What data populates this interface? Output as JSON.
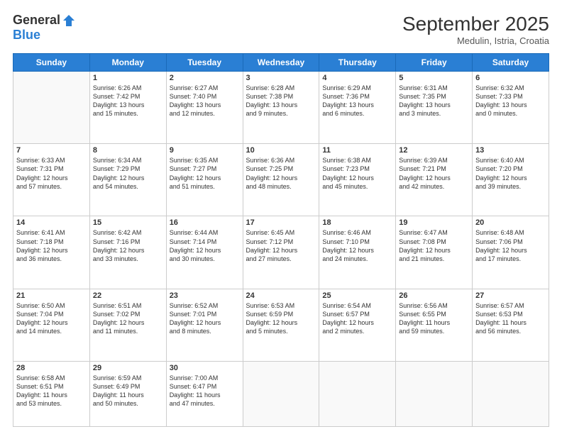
{
  "header": {
    "logo_general": "General",
    "logo_blue": "Blue",
    "month_title": "September 2025",
    "subtitle": "Medulin, Istria, Croatia"
  },
  "days_of_week": [
    "Sunday",
    "Monday",
    "Tuesday",
    "Wednesday",
    "Thursday",
    "Friday",
    "Saturday"
  ],
  "weeks": [
    [
      {
        "day": "",
        "content": ""
      },
      {
        "day": "1",
        "content": "Sunrise: 6:26 AM\nSunset: 7:42 PM\nDaylight: 13 hours\nand 15 minutes."
      },
      {
        "day": "2",
        "content": "Sunrise: 6:27 AM\nSunset: 7:40 PM\nDaylight: 13 hours\nand 12 minutes."
      },
      {
        "day": "3",
        "content": "Sunrise: 6:28 AM\nSunset: 7:38 PM\nDaylight: 13 hours\nand 9 minutes."
      },
      {
        "day": "4",
        "content": "Sunrise: 6:29 AM\nSunset: 7:36 PM\nDaylight: 13 hours\nand 6 minutes."
      },
      {
        "day": "5",
        "content": "Sunrise: 6:31 AM\nSunset: 7:35 PM\nDaylight: 13 hours\nand 3 minutes."
      },
      {
        "day": "6",
        "content": "Sunrise: 6:32 AM\nSunset: 7:33 PM\nDaylight: 13 hours\nand 0 minutes."
      }
    ],
    [
      {
        "day": "7",
        "content": "Sunrise: 6:33 AM\nSunset: 7:31 PM\nDaylight: 12 hours\nand 57 minutes."
      },
      {
        "day": "8",
        "content": "Sunrise: 6:34 AM\nSunset: 7:29 PM\nDaylight: 12 hours\nand 54 minutes."
      },
      {
        "day": "9",
        "content": "Sunrise: 6:35 AM\nSunset: 7:27 PM\nDaylight: 12 hours\nand 51 minutes."
      },
      {
        "day": "10",
        "content": "Sunrise: 6:36 AM\nSunset: 7:25 PM\nDaylight: 12 hours\nand 48 minutes."
      },
      {
        "day": "11",
        "content": "Sunrise: 6:38 AM\nSunset: 7:23 PM\nDaylight: 12 hours\nand 45 minutes."
      },
      {
        "day": "12",
        "content": "Sunrise: 6:39 AM\nSunset: 7:21 PM\nDaylight: 12 hours\nand 42 minutes."
      },
      {
        "day": "13",
        "content": "Sunrise: 6:40 AM\nSunset: 7:20 PM\nDaylight: 12 hours\nand 39 minutes."
      }
    ],
    [
      {
        "day": "14",
        "content": "Sunrise: 6:41 AM\nSunset: 7:18 PM\nDaylight: 12 hours\nand 36 minutes."
      },
      {
        "day": "15",
        "content": "Sunrise: 6:42 AM\nSunset: 7:16 PM\nDaylight: 12 hours\nand 33 minutes."
      },
      {
        "day": "16",
        "content": "Sunrise: 6:44 AM\nSunset: 7:14 PM\nDaylight: 12 hours\nand 30 minutes."
      },
      {
        "day": "17",
        "content": "Sunrise: 6:45 AM\nSunset: 7:12 PM\nDaylight: 12 hours\nand 27 minutes."
      },
      {
        "day": "18",
        "content": "Sunrise: 6:46 AM\nSunset: 7:10 PM\nDaylight: 12 hours\nand 24 minutes."
      },
      {
        "day": "19",
        "content": "Sunrise: 6:47 AM\nSunset: 7:08 PM\nDaylight: 12 hours\nand 21 minutes."
      },
      {
        "day": "20",
        "content": "Sunrise: 6:48 AM\nSunset: 7:06 PM\nDaylight: 12 hours\nand 17 minutes."
      }
    ],
    [
      {
        "day": "21",
        "content": "Sunrise: 6:50 AM\nSunset: 7:04 PM\nDaylight: 12 hours\nand 14 minutes."
      },
      {
        "day": "22",
        "content": "Sunrise: 6:51 AM\nSunset: 7:02 PM\nDaylight: 12 hours\nand 11 minutes."
      },
      {
        "day": "23",
        "content": "Sunrise: 6:52 AM\nSunset: 7:01 PM\nDaylight: 12 hours\nand 8 minutes."
      },
      {
        "day": "24",
        "content": "Sunrise: 6:53 AM\nSunset: 6:59 PM\nDaylight: 12 hours\nand 5 minutes."
      },
      {
        "day": "25",
        "content": "Sunrise: 6:54 AM\nSunset: 6:57 PM\nDaylight: 12 hours\nand 2 minutes."
      },
      {
        "day": "26",
        "content": "Sunrise: 6:56 AM\nSunset: 6:55 PM\nDaylight: 11 hours\nand 59 minutes."
      },
      {
        "day": "27",
        "content": "Sunrise: 6:57 AM\nSunset: 6:53 PM\nDaylight: 11 hours\nand 56 minutes."
      }
    ],
    [
      {
        "day": "28",
        "content": "Sunrise: 6:58 AM\nSunset: 6:51 PM\nDaylight: 11 hours\nand 53 minutes."
      },
      {
        "day": "29",
        "content": "Sunrise: 6:59 AM\nSunset: 6:49 PM\nDaylight: 11 hours\nand 50 minutes."
      },
      {
        "day": "30",
        "content": "Sunrise: 7:00 AM\nSunset: 6:47 PM\nDaylight: 11 hours\nand 47 minutes."
      },
      {
        "day": "",
        "content": ""
      },
      {
        "day": "",
        "content": ""
      },
      {
        "day": "",
        "content": ""
      },
      {
        "day": "",
        "content": ""
      }
    ]
  ]
}
